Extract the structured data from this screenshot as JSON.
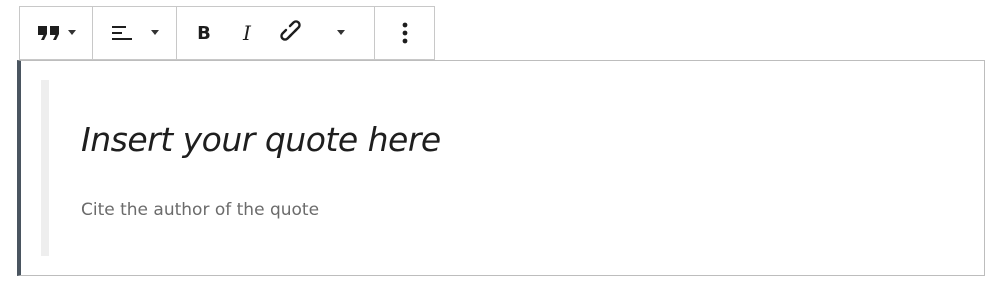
{
  "toolbar": {
    "block_type_icon": "quote-icon",
    "align_icon": "align-left-icon",
    "bold_label": "B",
    "italic_label": "I",
    "link_icon": "link-icon",
    "more_rich_text_icon": "chevron-down-icon",
    "options_icon": "more-vertical-icon"
  },
  "quote": {
    "text_placeholder": "Insert your quote here",
    "citation_placeholder": "Cite the author of the quote"
  }
}
